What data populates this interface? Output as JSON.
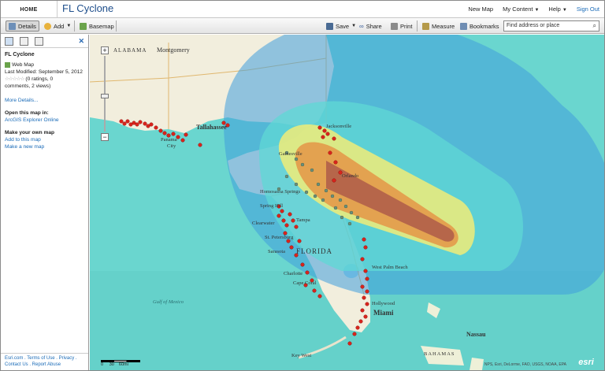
{
  "header": {
    "home_label": "HOME",
    "title": "FL Cyclone",
    "links": [
      "New Map",
      "My Content",
      "Help",
      "Sign Out"
    ]
  },
  "toolbar": {
    "details": "Details",
    "add": "Add",
    "basemap": "Basemap",
    "save": "Save",
    "share": "Share",
    "print": "Print",
    "measure": "Measure",
    "bookmarks": "Bookmarks",
    "search_placeholder": "Find address or place"
  },
  "sidebar": {
    "map_title": "FL Cyclone",
    "type": "Web Map",
    "modified": "Last Modified: September 5, 2012",
    "ratings": "(0 ratings, 0",
    "ratings2": "comments, 2 views)",
    "more": "More Details...",
    "open_heading": "Open this map in:",
    "open_link": "ArcGIS Explorer Online",
    "make_heading": "Make your own map",
    "make_add": "Add to this map",
    "make_new": "Make a new map",
    "footer1": "Esri.com . Terms of Use . Privacy .",
    "footer2": "Contact Us . Report Abuse"
  },
  "map": {
    "labels": {
      "alabama": "ALABAMA",
      "montgomery": "Montgomery",
      "tallahassee": "Tallahassee",
      "jacksonville": "Jacksonville",
      "panama": "Panama",
      "city": "City",
      "gulf": "Gulf of Mexico",
      "florida": "FLORIDA",
      "miami": "Miami",
      "nassau": "Nassau",
      "bahamas": "BAHAMAS",
      "keywest": "Key West",
      "orlando": "Orlando",
      "tampa": "Tampa",
      "clearwater": "Clearwater",
      "stpete": "St. Petersburg",
      "sarasota": "Sarasota",
      "charlotte": "Charlotte",
      "capecoral": "Cape Coral",
      "westpalm": "West Palm Beach",
      "hollywood": "Hollywood",
      "springhill": "Spring Hill",
      "homosassa": "Homosassa Springs",
      "gainesville": "Gainesville"
    },
    "scale": "0     30    60mi",
    "attribution": "NPS, Esri, DeLorme, FAO, USGS, NOAA, EPA",
    "logo": "esri",
    "colors": {
      "ocean": "#6ad6cf",
      "outer_cone": "#3f9fdc",
      "mid_cone": "#5fd0d0",
      "track": "#b6664a",
      "points_red": "#d8241c",
      "points_gray": "#6b8f7a"
    }
  }
}
